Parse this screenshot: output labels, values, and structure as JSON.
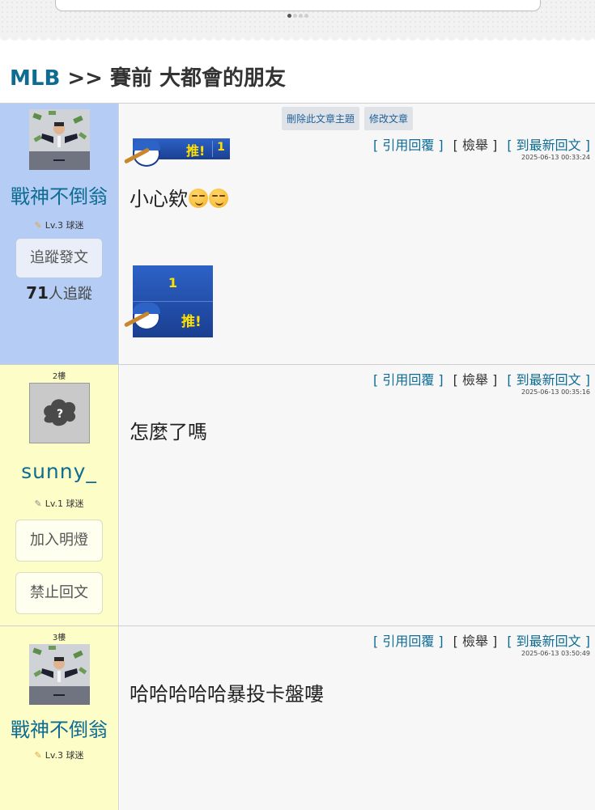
{
  "pager": {
    "total": 4,
    "active": 0
  },
  "breadcrumb": {
    "forum": "MLB",
    "separator": ">>",
    "title": "賽前 大都會的朋友"
  },
  "admin": {
    "delete_topic": "刪除此文章主題",
    "edit_post": "修改文章"
  },
  "post_actions": {
    "quote": "[ 引用回覆 ]",
    "report": "[ 檢舉 ]",
    "latest": "[ 到最新回文 ]"
  },
  "posts": [
    {
      "floor": "",
      "author": "戰神不倒翁",
      "level": "Lv.3 球迷",
      "side_buttons": [
        "追蹤發文"
      ],
      "followers_count": "71",
      "followers_label": "人追蹤",
      "timestamp": "2025-06-13 00:33:24",
      "message": "小心欸",
      "push": {
        "label": "推!",
        "count": "1"
      },
      "push_box": {
        "count": "1",
        "label": "推!"
      }
    },
    {
      "floor": "2樓",
      "author": "sunny_",
      "level": "Lv.1 球迷",
      "side_buttons": [
        "加入明燈",
        "禁止回文"
      ],
      "timestamp": "2025-06-13 00:35:16",
      "message": "怎麼了嗎"
    },
    {
      "floor": "3樓",
      "author": "戰神不倒翁",
      "level": "Lv.3 球迷",
      "timestamp": "2025-06-13 03:50:49",
      "message": "哈哈哈哈哈暴投卡盤嘍"
    }
  ],
  "colors": {
    "link": "#0e6c93",
    "owner_side": "#b5cdf5",
    "reply_side": "#fdfdc8",
    "push_badge": "#2d62c7"
  }
}
